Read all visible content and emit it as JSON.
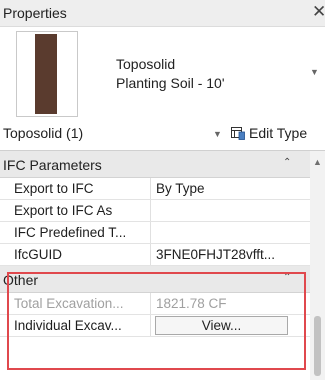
{
  "palette": {
    "panel_bg": "#ffffff",
    "header_bg": "#eeeeee",
    "group_bg": "#e9e9e9",
    "thumbnail_fill": "#5a3b2e",
    "disabled_text": "#a0a0a0",
    "highlight": "#e0484d"
  },
  "panel": {
    "title": "Properties",
    "close_glyph": "✕"
  },
  "type_selector": {
    "family": "Toposolid",
    "type": "Planting Soil - 10'",
    "dropdown_glyph": "▼"
  },
  "selection_bar": {
    "filter": "Toposolid (1)",
    "dropdown_glyph": "▼",
    "edit_type_label": "Edit Type",
    "edit_type_icon": "edit-type-icon"
  },
  "groups": {
    "ifc": {
      "label": "IFC Parameters",
      "chevron_glyph": "⌃",
      "rows": [
        {
          "name": "Export to IFC",
          "value": "By Type"
        },
        {
          "name": "Export to IFC As",
          "value": ""
        },
        {
          "name": "IFC Predefined T...",
          "value": ""
        },
        {
          "name": "IfcGUID",
          "value": "3FNE0FHJT28vfft..."
        }
      ]
    },
    "other": {
      "label": "Other",
      "chevron_glyph": "⌃",
      "rows": [
        {
          "name": "Total Excavation...",
          "value": "1821.78 CF",
          "enabled": false
        },
        {
          "name": "Individual Excav...",
          "button_label": "View...",
          "enabled": true
        }
      ]
    }
  },
  "scrollbar": {
    "up_glyph": "▲"
  }
}
